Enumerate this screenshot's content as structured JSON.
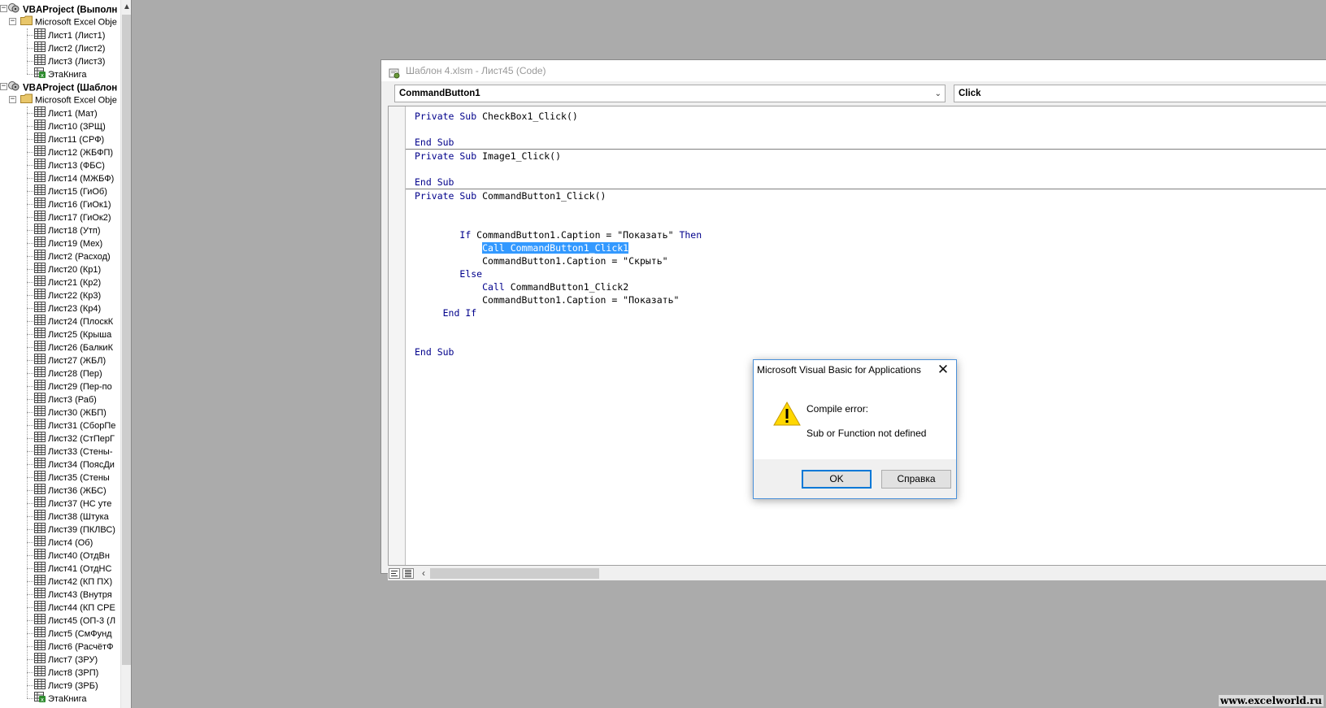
{
  "project_explorer": {
    "projects": [
      {
        "name": "VBAProject (Выполн",
        "folder": "Microsoft Excel Obje",
        "items": [
          "Лист1 (Лист1)",
          "Лист2 (Лист2)",
          "Лист3 (Лист3)",
          "ЭтаКнига"
        ]
      },
      {
        "name": "VBAProject (Шаблон",
        "folder": "Microsoft Excel Obje",
        "items": [
          "Лист1 (Мат)",
          "Лист10 (ЗРЩ)",
          "Лист11 (СРФ)",
          "Лист12 (ЖБФП)",
          "Лист13 (ФБС)",
          "Лист14 (МЖБФ)",
          "Лист15 (ГиОб)",
          "Лист16 (ГиОк1)",
          "Лист17 (ГиОк2)",
          "Лист18 (Утп)",
          "Лист19 (Мех)",
          "Лист2 (Расход)",
          "Лист20 (Кр1)",
          "Лист21 (Кр2)",
          "Лист22 (Кр3)",
          "Лист23 (Кр4)",
          "Лист24 (ПлоскК",
          "Лист25 (Крыша",
          "Лист26 (БалкиК",
          "Лист27 (ЖБЛ)",
          "Лист28 (Пер)",
          "Лист29 (Пер-по",
          "Лист3 (Раб)",
          "Лист30 (ЖБП)",
          "Лист31 (СборПе",
          "Лист32 (СтПерГ",
          "Лист33 (Стены-",
          "Лист34 (ПоясДи",
          "Лист35 (Стены",
          "Лист36 (ЖБС)",
          "Лист37 (НС уте",
          "Лист38 (Штука",
          "Лист39 (ПКЛВС)",
          "Лист4 (Об)",
          "Лист40 (ОтдВн",
          "Лист41 (ОтдНС",
          "Лист42 (КП ПХ)",
          "Лист43 (Внутря",
          "Лист44 (КП СРЕ",
          "Лист45 (ОП-3 (Л",
          "Лист5 (СмФунд",
          "Лист6 (РасчётФ",
          "Лист7 (ЗРУ)",
          "Лист8 (ЗРП)",
          "Лист9 (ЗРБ)",
          "ЭтаКнига"
        ]
      }
    ]
  },
  "code_window": {
    "title": "Шаблон 4.xlsm - Лист45 (Code)",
    "object_combo": "CommandButton1",
    "procedure_combo": "Click",
    "lines": [
      {
        "indent": "",
        "parts": [
          {
            "t": "Private Sub",
            "k": true
          },
          {
            "t": " CheckBox1_Click()"
          }
        ]
      },
      {
        "indent": "",
        "parts": []
      },
      {
        "indent": "",
        "parts": [
          {
            "t": "End Sub",
            "k": true
          }
        ]
      },
      {
        "sep": true
      },
      {
        "indent": "",
        "parts": [
          {
            "t": "Private Sub",
            "k": true
          },
          {
            "t": " Image1_Click()"
          }
        ]
      },
      {
        "indent": "",
        "parts": []
      },
      {
        "indent": "",
        "parts": [
          {
            "t": "End Sub",
            "k": true
          }
        ]
      },
      {
        "sep": true
      },
      {
        "indent": "",
        "parts": [
          {
            "t": "Private Sub",
            "k": true
          },
          {
            "t": " CommandButton1_Click()"
          }
        ]
      },
      {
        "indent": "",
        "parts": []
      },
      {
        "indent": "",
        "parts": []
      },
      {
        "indent": "        ",
        "parts": [
          {
            "t": "If",
            "k": true
          },
          {
            "t": " CommandButton1.Caption = \"Показать\" "
          },
          {
            "t": "Then",
            "k": true
          }
        ]
      },
      {
        "indent": "            ",
        "parts": [
          {
            "t": "Call CommandButton1_Click1",
            "h": true
          }
        ]
      },
      {
        "indent": "            ",
        "parts": [
          {
            "t": "CommandButton1.Caption = \"Скрыть\""
          }
        ]
      },
      {
        "indent": "        ",
        "parts": [
          {
            "t": "Else",
            "k": true
          }
        ]
      },
      {
        "indent": "            ",
        "parts": [
          {
            "t": "Call",
            "k": true
          },
          {
            "t": " CommandButton1_Click2"
          }
        ]
      },
      {
        "indent": "            ",
        "parts": [
          {
            "t": "CommandButton1.Caption = \"Показать\""
          }
        ]
      },
      {
        "indent": "     ",
        "parts": [
          {
            "t": "End If",
            "k": true
          }
        ]
      },
      {
        "indent": "",
        "parts": []
      },
      {
        "indent": "",
        "parts": []
      },
      {
        "indent": "",
        "parts": [
          {
            "t": "End Sub",
            "k": true
          }
        ]
      }
    ]
  },
  "dialog": {
    "title": "Microsoft Visual Basic for Applications",
    "message_line1": "Compile error:",
    "message_line2": "Sub or Function not defined",
    "ok_label": "OK",
    "help_label": "Справка"
  },
  "watermark": "www.excelworld.ru",
  "colors": {
    "keyword": "#00008b",
    "selection": "#3399ff",
    "workspace": "#ababab"
  }
}
